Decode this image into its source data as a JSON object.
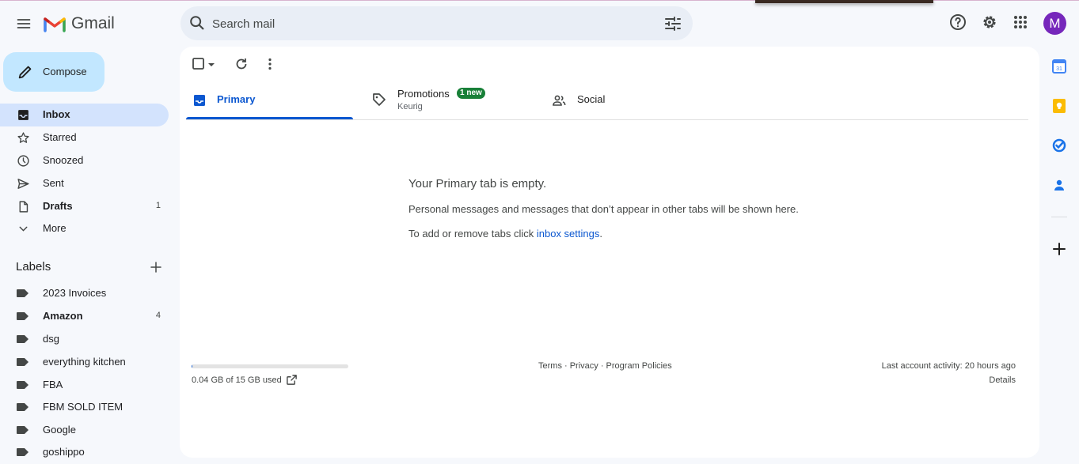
{
  "app": {
    "name": "Gmail",
    "avatar_letter": "M",
    "avatar_color": "#7627bb"
  },
  "search": {
    "placeholder": "Search mail"
  },
  "compose": {
    "label": "Compose"
  },
  "nav": [
    {
      "label": "Inbox",
      "count": "",
      "icon": "inbox-icon",
      "active": true
    },
    {
      "label": "Starred",
      "count": "",
      "icon": "star-icon"
    },
    {
      "label": "Snoozed",
      "count": "",
      "icon": "clock-icon"
    },
    {
      "label": "Sent",
      "count": "",
      "icon": "send-icon"
    },
    {
      "label": "Drafts",
      "count": "1",
      "icon": "draft-icon",
      "bold": true
    },
    {
      "label": "More",
      "count": "",
      "icon": "chevron-down-icon"
    }
  ],
  "labels": {
    "title": "Labels",
    "items": [
      {
        "label": "2023 Invoices",
        "count": ""
      },
      {
        "label": "Amazon",
        "count": "4",
        "bold": true
      },
      {
        "label": "dsg",
        "count": ""
      },
      {
        "label": "everything kitchen",
        "count": ""
      },
      {
        "label": "FBA",
        "count": ""
      },
      {
        "label": "FBM SOLD ITEM",
        "count": ""
      },
      {
        "label": "Google",
        "count": ""
      },
      {
        "label": "goshippo",
        "count": ""
      }
    ]
  },
  "tabs": [
    {
      "label": "Primary",
      "icon": "inbox-tab-icon",
      "active": true
    },
    {
      "label": "Promotions",
      "sub": "Keurig",
      "badge": "1 new",
      "icon": "tag-icon"
    },
    {
      "label": "Social",
      "icon": "people-icon"
    }
  ],
  "empty_state": {
    "title": "Your Primary tab is empty.",
    "description": "Personal messages and messages that don’t appear in other tabs will be shown here.",
    "settings_prefix": "To add or remove tabs click ",
    "settings_link": "inbox settings",
    "settings_suffix": "."
  },
  "footer": {
    "storage_text": "0.04 GB of 15 GB used",
    "storage_fraction": 0.0027,
    "links": "Terms · Privacy · Program Policies",
    "last_activity": "Last account activity: 20 hours ago",
    "details": "Details"
  },
  "colors": {
    "accent": "#0b57d0",
    "compose_bg": "#c2e7ff",
    "active_nav": "#d3e3fd",
    "badge": "#188038"
  }
}
